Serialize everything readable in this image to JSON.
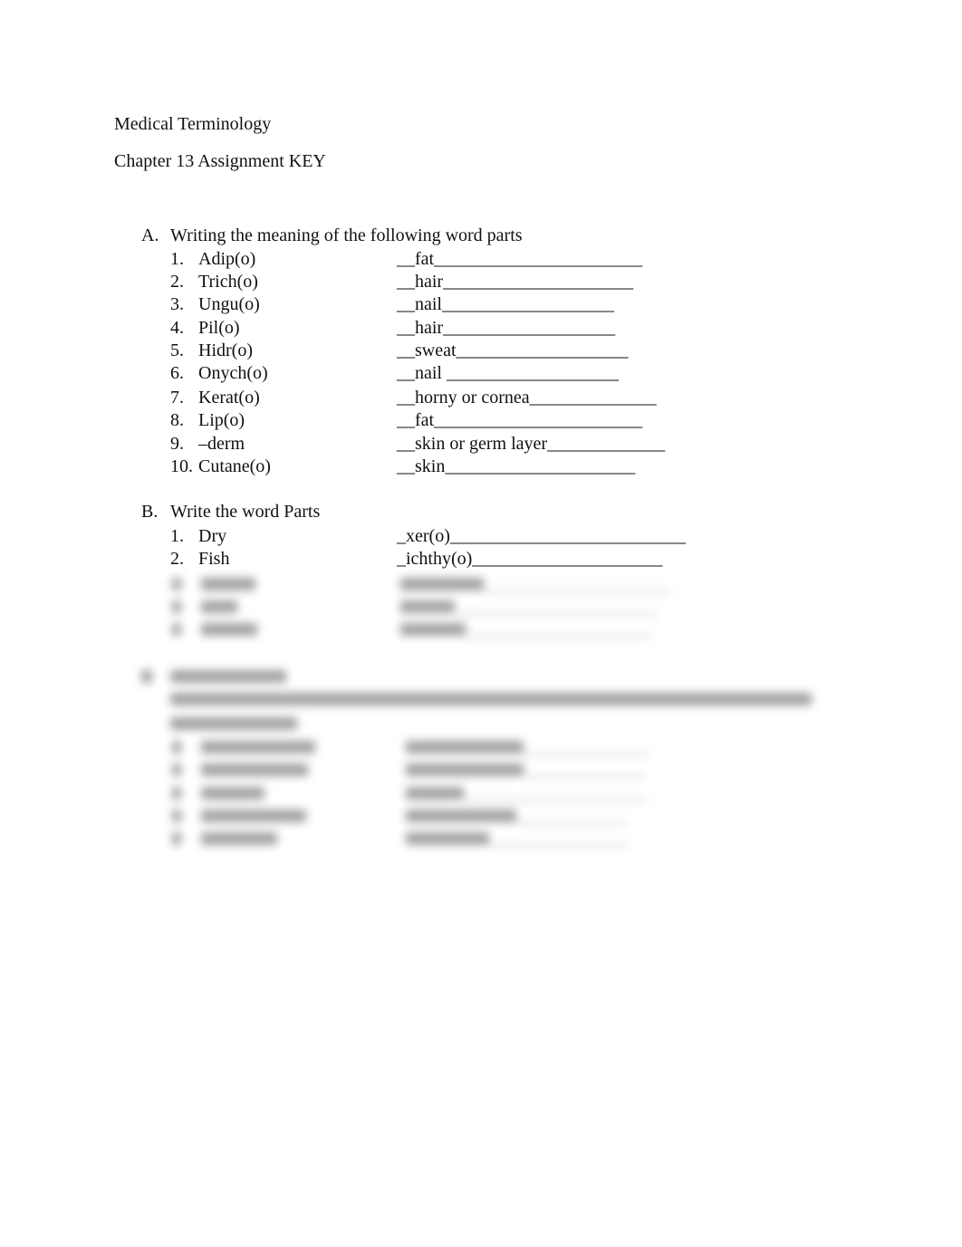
{
  "document": {
    "course_title": "Medical Terminology",
    "assignment_title": "Chapter 13 Assignment KEY"
  },
  "sections": [
    {
      "letter": "A.",
      "title": "Writing the meaning of the following word parts",
      "items": [
        {
          "num": "1.",
          "term": "Adip(o)",
          "answer": "__fat_______________________"
        },
        {
          "num": "2.",
          "term": "Trich(o)",
          "answer": "__hair_____________________"
        },
        {
          "num": "3.",
          "term": "Ungu(o)",
          "answer": "__nail___________________"
        },
        {
          "num": "4.",
          "term": "Pil(o)",
          "answer": "__hair___________________"
        },
        {
          "num": "5.",
          "term": "Hidr(o)",
          "answer": "__sweat___________________"
        },
        {
          "num": "6.",
          "term": "Onych(o)",
          "answer": "__nail ___________________"
        },
        {
          "num": "7.",
          "term": "Kerat(o)",
          "answer": "__horny or cornea______________"
        },
        {
          "num": "8.",
          "term": "Lip(o)",
          "answer": "__fat_______________________"
        },
        {
          "num": "9.",
          "term": "–derm",
          "answer": "__skin or germ layer_____________"
        },
        {
          "num": "10.",
          "term": "Cutane(o)",
          "answer": "__skin_____________________"
        }
      ]
    },
    {
      "letter": "B.",
      "title": "Write the word Parts",
      "items": [
        {
          "num": "1.",
          "term": "Dry",
          "answer": "_xer(o)__________________________"
        },
        {
          "num": "2.",
          "term": "Fish",
          "answer": "_ichthy(o)_____________________"
        }
      ],
      "obscured_item_count": 3
    }
  ],
  "obscured": {
    "note": "Remaining content is blurred and illegible in the source",
    "section_c_item_count": 5
  }
}
